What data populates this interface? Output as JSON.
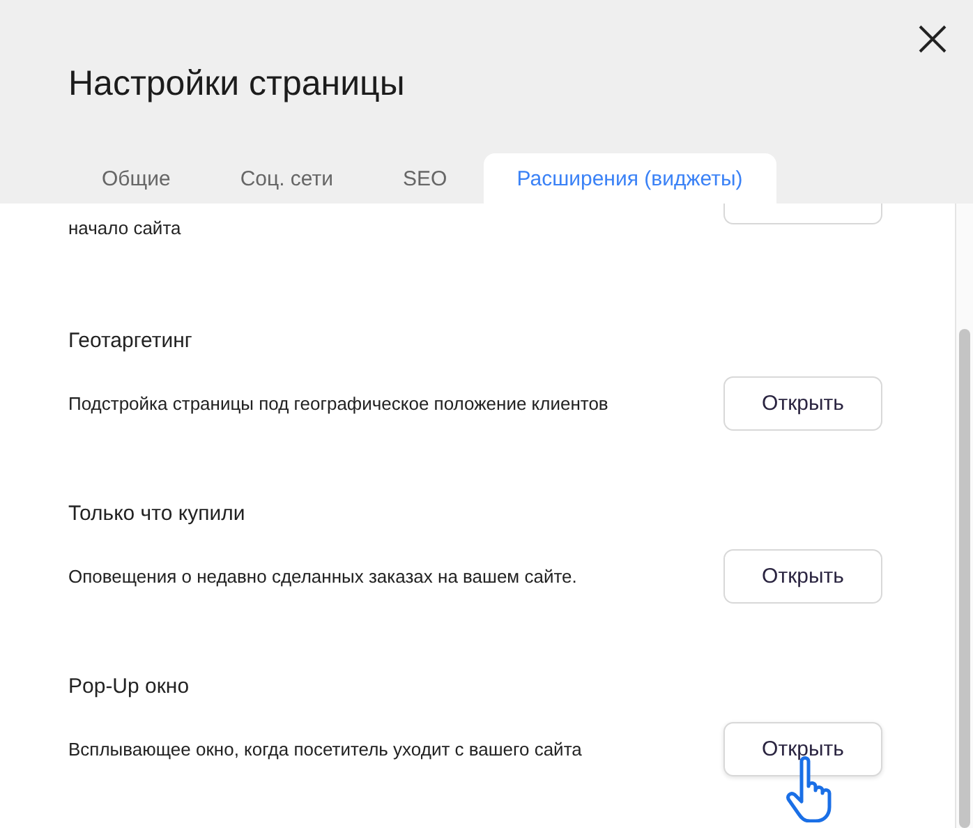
{
  "dialog": {
    "title": "Настройки страницы"
  },
  "tabs": [
    {
      "label": "Общие",
      "selected": false
    },
    {
      "label": "Соц. сети",
      "selected": false
    },
    {
      "label": "SEO",
      "selected": false
    },
    {
      "label": "Расширения (виджеты)",
      "selected": true
    }
  ],
  "partial_item": {
    "description": "начало сайта"
  },
  "widgets": [
    {
      "title": "Геотаргетинг",
      "description": "Подстройка страницы под географическое положение клиентов",
      "button": "Открыть",
      "hovered": false
    },
    {
      "title": "Только что купили",
      "description": "Оповещения о недавно сделанных заказах на вашем сайте.",
      "button": "Открыть",
      "hovered": false
    },
    {
      "title": "Pop-Up окно",
      "description": "Всплывающее окно, когда посетитель уходит с вашего сайта",
      "button": "Открыть",
      "hovered": true
    }
  ]
}
